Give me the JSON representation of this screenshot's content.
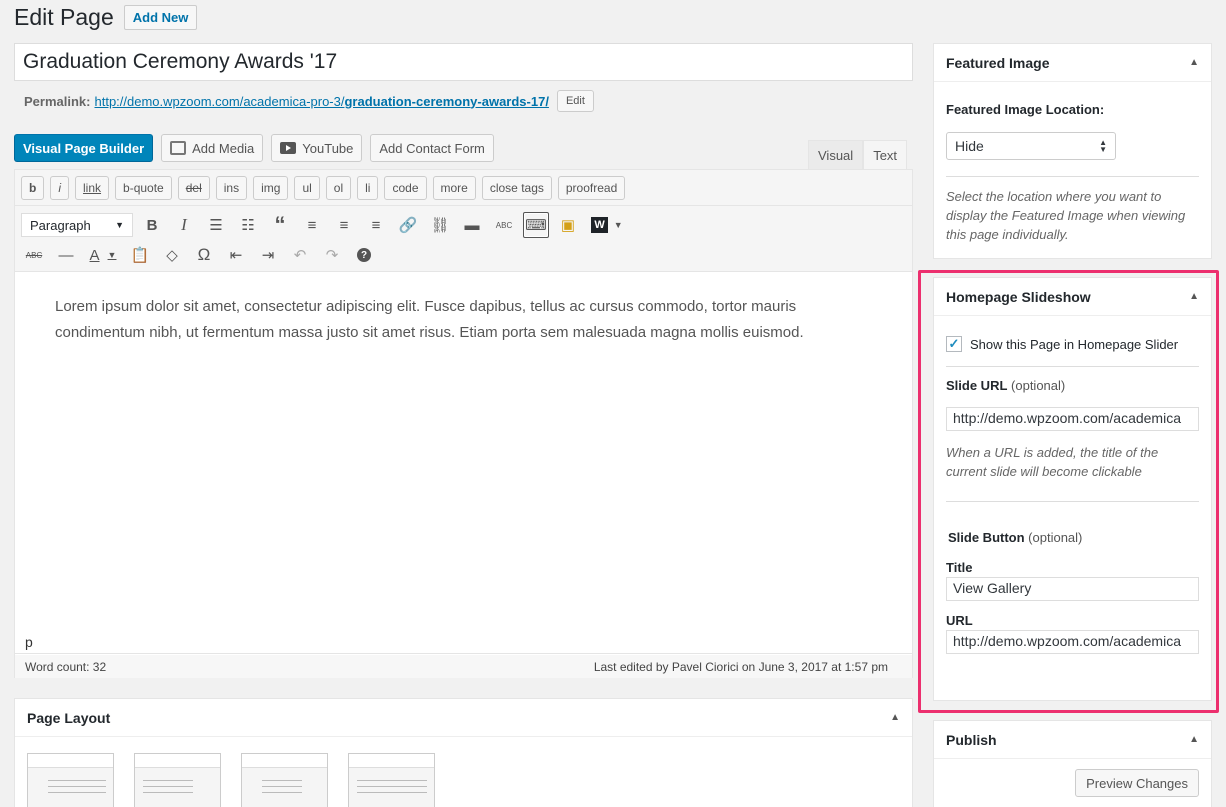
{
  "header": {
    "title": "Edit Page",
    "add_new": "Add New"
  },
  "post": {
    "title": "Graduation Ceremony Awards '17",
    "permalink_label": "Permalink:",
    "permalink_base": "http://demo.wpzoom.com/academica-pro-3/",
    "permalink_slug": "graduation-ceremony-awards-17/",
    "edit_label": "Edit"
  },
  "media_buttons": {
    "builder": "Visual Page Builder",
    "add_media": "Add Media",
    "youtube": "YouTube",
    "contact_form": "Add Contact Form"
  },
  "editor_tabs": {
    "visual": "Visual",
    "text": "Text"
  },
  "quicktags": [
    "b",
    "i",
    "link",
    "b-quote",
    "del",
    "ins",
    "img",
    "ul",
    "ol",
    "li",
    "code",
    "more",
    "close tags",
    "proofread"
  ],
  "toolbar": {
    "format": "Paragraph",
    "row1_icons": [
      "bold-icon",
      "italic-icon",
      "bullet-list-icon",
      "numbered-list-icon",
      "blockquote-icon",
      "align-left-icon",
      "align-center-icon",
      "align-right-icon",
      "link-icon",
      "unlink-icon",
      "read-more-icon",
      "spellcheck-icon",
      "toolbar-toggle-icon",
      "gallery-icon",
      "wpzoom-icon"
    ],
    "row2_icons": [
      "strikethrough-icon",
      "horizontal-line-icon",
      "text-color-icon",
      "paste-text-icon",
      "clear-format-icon",
      "special-char-icon",
      "outdent-icon",
      "indent-icon",
      "undo-icon",
      "redo-icon",
      "help-icon"
    ]
  },
  "content": {
    "body": "Lorem ipsum dolor sit amet, consectetur adipiscing elit. Fusce dapibus, tellus ac cursus commodo, tortor mauris condimentum nibh, ut fermentum massa justo sit amet risus. Etiam porta sem malesuada magna mollis euismod.",
    "path": "p",
    "word_count": "Word count: 32",
    "last_edited": "Last edited by Pavel Ciorici on June 3, 2017 at 1:57 pm"
  },
  "page_layout": {
    "title": "Page Layout"
  },
  "featured_image": {
    "title": "Featured Image",
    "location_label": "Featured Image Location:",
    "location_value": "Hide",
    "description": "Select the location where you want to display the Featured Image when viewing this page individually."
  },
  "slideshow": {
    "title": "Homepage Slideshow",
    "show_label": "Show this Page in Homepage Slider",
    "show_checked": true,
    "slide_url_label": "Slide URL",
    "optional": "(optional)",
    "slide_url_value": "http://demo.wpzoom.com/academica",
    "slide_url_desc": "When a URL is added, the title of the current slide will become clickable",
    "slide_button_label": "Slide Button",
    "title_label": "Title",
    "title_value": "View Gallery",
    "url_label": "URL",
    "url_value": "http://demo.wpzoom.com/academica"
  },
  "publish": {
    "title": "Publish",
    "preview": "Preview Changes"
  },
  "colors": {
    "primary": "#0085ba",
    "link": "#0073aa",
    "highlight": "#ec2f6e"
  }
}
